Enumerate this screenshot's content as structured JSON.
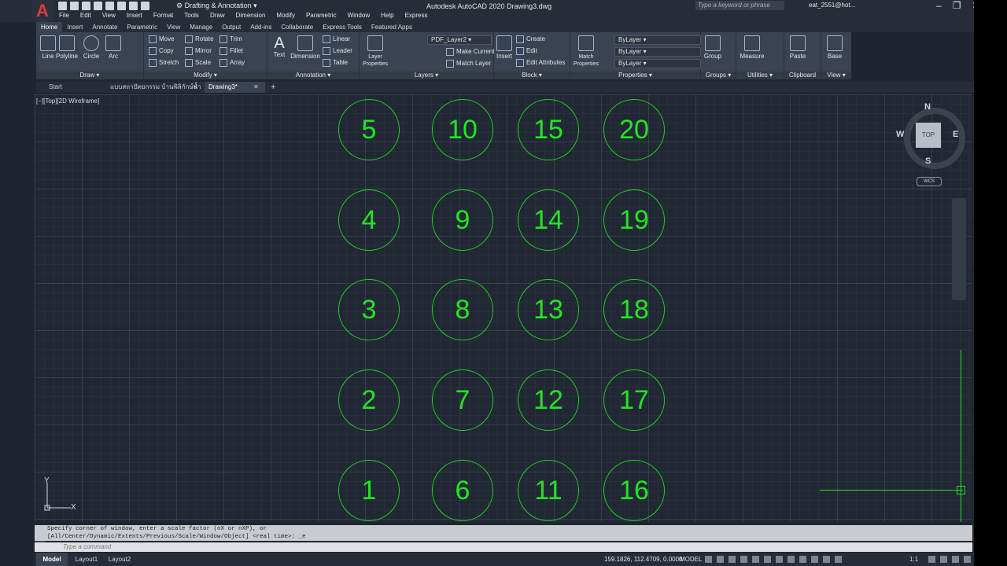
{
  "app": {
    "title": "Autodesk AutoCAD 2020   Drawing3.dwg",
    "logo": "A",
    "workspace": "Drafting & Annotation",
    "search_placeholder": "Type a keyword or phrase",
    "user": "eat_2551@hot..."
  },
  "menu": [
    "File",
    "Edit",
    "View",
    "Insert",
    "Format",
    "Tools",
    "Draw",
    "Dimension",
    "Modify",
    "Parametric",
    "Window",
    "Help",
    "Express"
  ],
  "ribbon_tabs": [
    "Home",
    "Insert",
    "Annotate",
    "Parametric",
    "View",
    "Manage",
    "Output",
    "Add-ins",
    "Collaborate",
    "Express Tools",
    "Featured Apps"
  ],
  "panels": {
    "draw": {
      "label": "Draw",
      "line": "Line",
      "polyline": "Polyline",
      "circle": "Circle",
      "arc": "Arc"
    },
    "modify": {
      "label": "Modify",
      "move": "Move",
      "rotate": "Rotate",
      "trim": "Trim",
      "copy": "Copy",
      "mirror": "Mirror",
      "fillet": "Fillet",
      "stretch": "Stretch",
      "scale": "Scale",
      "array": "Array"
    },
    "annotation": {
      "label": "Annotation",
      "text": "Text",
      "dimension": "Dimension",
      "linear": "Linear",
      "leader": "Leader",
      "table": "Table"
    },
    "layers": {
      "label": "Layers",
      "properties": "Layer Properties",
      "current_layer": "PDF_Layer2",
      "make_current": "Make Current",
      "match_layer": "Match Layer"
    },
    "block": {
      "label": "Block",
      "insert": "Insert",
      "create": "Create",
      "edit": "Edit",
      "edit_attributes": "Edit Attributes"
    },
    "properties": {
      "label": "Properties",
      "match": "Match Properties",
      "color": "ByLayer",
      "linetype": "ByLayer",
      "lineweight": "ByLayer"
    },
    "groups": {
      "label": "Groups",
      "group": "Group"
    },
    "utilities": {
      "label": "Utilities",
      "measure": "Measure"
    },
    "clipboard": {
      "label": "Clipboard",
      "paste": "Paste"
    },
    "view": {
      "label": "View",
      "base": "Base"
    }
  },
  "file_tabs": [
    {
      "label": "Start"
    },
    {
      "label": "แบบสถาปัตยกรรม บ้านพิลิกักษ์น้ำ 3*"
    },
    {
      "label": "Drawing3*"
    }
  ],
  "viewport": {
    "label": "[−][Top][2D Wireframe]",
    "circles": [
      {
        "label": "5"
      },
      {
        "label": "10"
      },
      {
        "label": "15"
      },
      {
        "label": "20"
      },
      {
        "label": "4"
      },
      {
        "label": "9"
      },
      {
        "label": "14"
      },
      {
        "label": "19"
      },
      {
        "label": "3"
      },
      {
        "label": "8"
      },
      {
        "label": "13"
      },
      {
        "label": "18"
      },
      {
        "label": "2"
      },
      {
        "label": "7"
      },
      {
        "label": "12"
      },
      {
        "label": "17"
      },
      {
        "label": "1"
      },
      {
        "label": "6"
      },
      {
        "label": "11"
      },
      {
        "label": "16"
      }
    ],
    "viewcube": {
      "top": "TOP",
      "n": "N",
      "s": "S",
      "e": "E",
      "w": "W",
      "wcs": "WCS"
    },
    "ucs": {
      "x": "X",
      "y": "Y"
    }
  },
  "command": {
    "history_1": "Specify corner of window, enter a scale factor (nX or nXP), or",
    "history_2": "[All/Center/Dynamic/Extents/Previous/Scale/Window/Object] <real time>: _e",
    "placeholder": "Type a command"
  },
  "status": {
    "tabs": [
      "Model",
      "Layout1",
      "Layout2"
    ],
    "coords": "159.1826, 112.4709, 0.0000",
    "mode": "MODEL",
    "scale": "1:1"
  },
  "colors": {
    "entity": "#22e522",
    "background": "#212834"
  }
}
